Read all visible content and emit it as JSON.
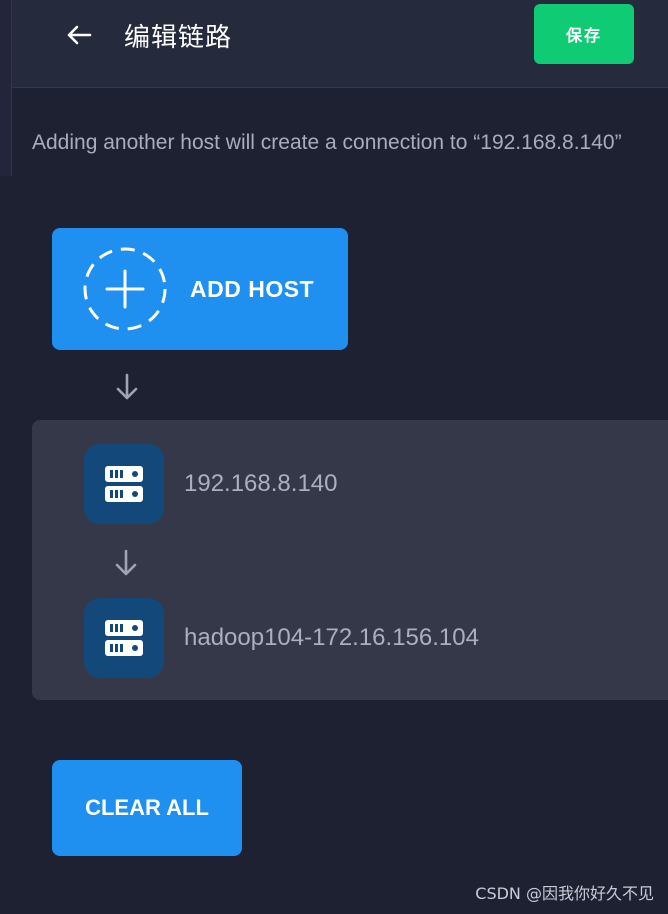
{
  "header": {
    "title": "编辑链路",
    "back_icon": "arrow-left-icon",
    "save_label": "保存"
  },
  "description": "Adding another host will create a connection to “192.168.8.140”",
  "add_host": {
    "label": "ADD HOST",
    "icon": "dashed-plus-circle-icon"
  },
  "chain": {
    "hosts": [
      {
        "label": "192.168.8.140",
        "icon": "server-icon"
      },
      {
        "label": "hadoop104-172.16.156.104",
        "icon": "server-icon"
      }
    ],
    "connector_icon": "arrow-down-icon"
  },
  "clear_all_label": "CLEAR ALL",
  "watermark": "CSDN @因我你好久不见",
  "colors": {
    "background": "#1e2132",
    "header": "#262a3d",
    "primary_button": "#1f8ff0",
    "save_button": "#0fcb73",
    "panel": "#343849",
    "host_icon_bg": "#12497a"
  }
}
